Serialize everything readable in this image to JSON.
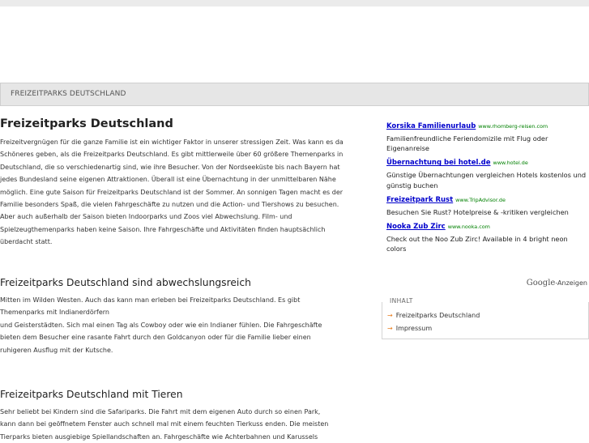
{
  "breadcrumb": {
    "label": "FREIZEITPARKS DEUTSCHLAND"
  },
  "main": {
    "title": "Freizeitparks Deutschland",
    "intro_lines": [
      "Freizeitvergnügen für die ganze Familie ist ein wichtiger Faktor in unserer stressigen Zeit. Was kann es da",
      "Schöneres geben, als die Freizeitparks Deutschland. Es gibt mittlerweile über 60 größere Themenparks in",
      "Deutschland, die so verschiedenartig sind, wie ihre Besucher. Von der Nordseeküste bis nach Bayern hat",
      "jedes Bundesland seine eigenen Attraktionen. Überall ist eine Übernachtung in der unmittelbaren Nähe",
      "möglich. Eine gute Saison für Freizeitparks Deutschland ist der Sommer. An sonnigen Tagen macht es der",
      "Familie besonders Spaß, die vielen Fahrgeschäfte zu nutzen und die Action- und Tiershows zu besuchen.",
      "Aber auch außerhalb der Saison bieten Indoorparks und Zoos viel Abwechslung. Film- und",
      "Spielzeugthemenparks haben keine Saison. Ihre Fahrgeschäfte und Aktivitäten finden hauptsächlich",
      "überdacht statt."
    ],
    "sections": [
      {
        "title": "Freizeitparks Deutschland sind abwechslungsreich",
        "lines": [
          "Mitten im Wilden Westen. Auch das kann man erleben bei Freizeitparks Deutschland. Es gibt",
          "Themenparks mit Indianerdörfern",
          "und Geisterstädten. Sich mal einen Tag als Cowboy oder wie ein Indianer fühlen. Die Fahrgeschäfte",
          "bieten dem Besucher eine rasante Fahrt durch den Goldcanyon oder für die Familie lieber einen",
          "ruhigeren Ausflug mit der Kutsche."
        ]
      },
      {
        "title": "Freizeitparks Deutschland mit Tieren",
        "lines": [
          "Sehr beliebt bei Kindern sind die Safariparks. Die Fahrt mit dem eigenen Auto durch so einen Park,",
          "kann dann bei geöffnetem Fenster auch schnell mal mit einem feuchten Tierkuss enden. Die meisten",
          "Tierparks bieten ausgiebige Spiellandschaften an. Fahrgeschäfte wie Achterbahnen und Karussels"
        ]
      }
    ]
  },
  "ads": {
    "items": [
      {
        "title": "Korsika Familienurlaub",
        "url": "www.rhomberg-reisen.com",
        "desc": "Familienfreundliche Feriendomizile mit Flug oder Eigenanreise"
      },
      {
        "title": "Übernachtung bei hotel.de",
        "url": "www.hotel.de",
        "desc": "Günstige Übernachtungen vergleichen Hotels kostenlos und günstig buchen"
      },
      {
        "title": "Freizeitpark Rust",
        "url": "www.TripAdvisor.de",
        "desc": "Besuchen Sie Rust? Hotelpreise & -kritiken vergleichen"
      },
      {
        "title": "Nooka Zub Zirc",
        "url": "www.nooka.com",
        "desc": "Check out the Noo Zub Zirc! Available in 4 bright neon colors"
      }
    ],
    "attribution_logo": "Google",
    "attribution_text": "-Anzeigen"
  },
  "inhalt": {
    "title": "INHALT",
    "items": [
      "Freizeitparks Deutschland",
      "Impressum"
    ]
  },
  "colors": {
    "link": "#0000cc",
    "ad_url": "#008000",
    "bullet_arrow": "#e87d1e"
  }
}
